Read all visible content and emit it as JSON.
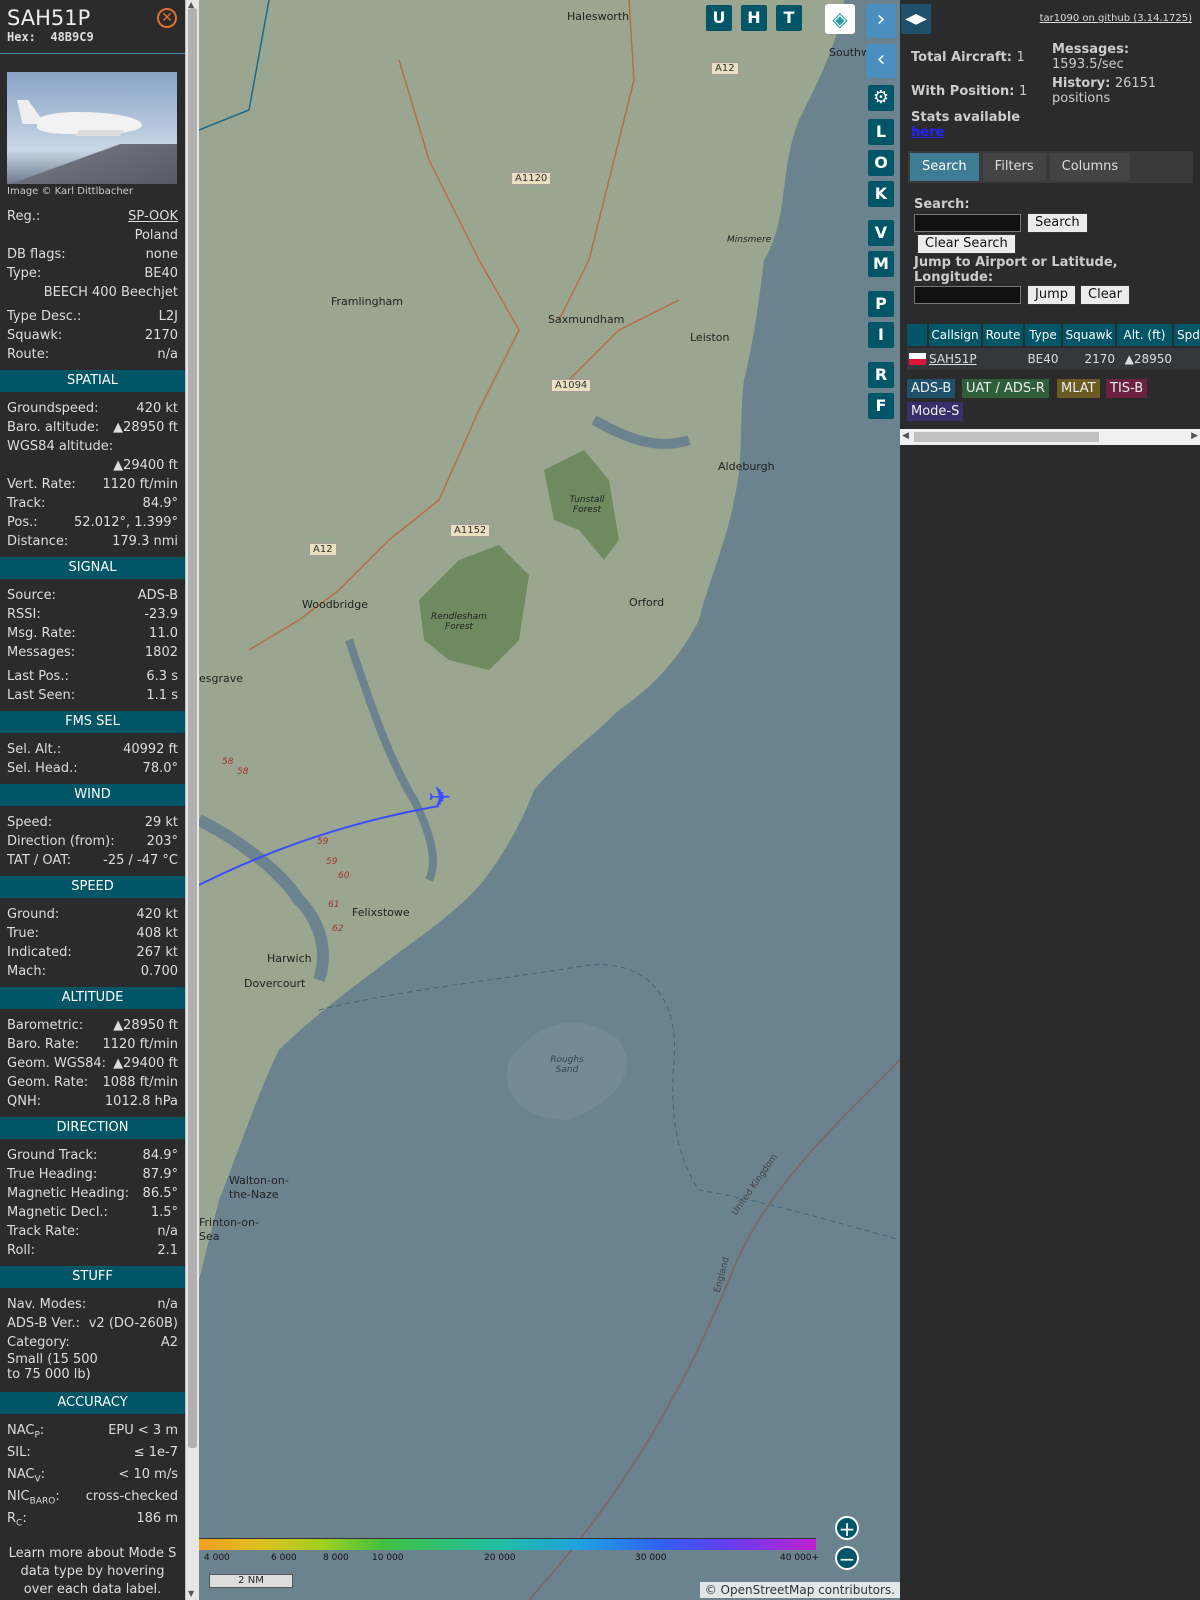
{
  "aircraft": {
    "callsign": "SAH51P",
    "hex_label": "Hex:",
    "hex": "48B9C9",
    "image_credit": "Image © Karl Dittlbacher",
    "reg_label": "Reg.:",
    "reg": "SP-OOK",
    "country": "Poland",
    "dbflags_label": "DB flags:",
    "dbflags": "none",
    "type_label": "Type:",
    "type": "BE40",
    "type_full": "BEECH 400 Beechjet",
    "typedesc_label": "Type Desc.:",
    "typedesc": "L2J",
    "squawk_label": "Squawk:",
    "squawk": "2170",
    "route_label": "Route:",
    "route": "n/a"
  },
  "sections": {
    "spatial": "SPATIAL",
    "signal": "SIGNAL",
    "fms": "FMS SEL",
    "wind": "WIND",
    "speed": "SPEED",
    "altitude": "ALTITUDE",
    "direction": "DIRECTION",
    "stuff": "STUFF",
    "accuracy": "ACCURACY"
  },
  "spatial": {
    "gs_label": "Groundspeed:",
    "gs": "420 kt",
    "baro_label": "Baro. altitude:",
    "baro": "▲28950 ft",
    "wgs_label": "WGS84 altitude:",
    "wgs": "▲29400 ft",
    "vr_label": "Vert. Rate:",
    "vr": "1120 ft/min",
    "track_label": "Track:",
    "track": "84.9°",
    "pos_label": "Pos.:",
    "pos": "52.012°, 1.399°",
    "dist_label": "Distance:",
    "dist": "179.3 nmi"
  },
  "signal": {
    "src_label": "Source:",
    "src": "ADS-B",
    "rssi_label": "RSSI:",
    "rssi": "-23.9",
    "rate_label": "Msg. Rate:",
    "rate": "11.0",
    "msgs_label": "Messages:",
    "msgs": "1802",
    "lpos_label": "Last Pos.:",
    "lpos": "6.3 s",
    "lseen_label": "Last Seen:",
    "lseen": "1.1 s"
  },
  "fms": {
    "alt_label": "Sel. Alt.:",
    "alt": "40992 ft",
    "head_label": "Sel. Head.:",
    "head": "78.0°"
  },
  "wind": {
    "spd_label": "Speed:",
    "spd": "29 kt",
    "dir_label": "Direction (from):",
    "dir": "203°",
    "tat_label": "TAT / OAT:",
    "tat": "-25 / -47 °C"
  },
  "speed": {
    "ground_label": "Ground:",
    "ground": "420 kt",
    "true_label": "True:",
    "true": "408 kt",
    "ind_label": "Indicated:",
    "ind": "267 kt",
    "mach_label": "Mach:",
    "mach": "0.700"
  },
  "altitude": {
    "baro_label": "Barometric:",
    "baro": "▲28950 ft",
    "brate_label": "Baro. Rate:",
    "brate": "1120 ft/min",
    "geom_label": "Geom. WGS84:",
    "geom": "▲29400 ft",
    "grate_label": "Geom. Rate:",
    "grate": "1088 ft/min",
    "qnh_label": "QNH:",
    "qnh": "1012.8 hPa"
  },
  "direction": {
    "gt_label": "Ground Track:",
    "gt": "84.9°",
    "th_label": "True Heading:",
    "th": "87.9°",
    "mh_label": "Magnetic Heading:",
    "mh": "86.5°",
    "md_label": "Magnetic Decl.:",
    "md": "1.5°",
    "tr_label": "Track Rate:",
    "tr": "n/a",
    "roll_label": "Roll:",
    "roll": "2.1"
  },
  "stuff": {
    "nav_label": "Nav. Modes:",
    "nav": "n/a",
    "adsb_label": "ADS-B Ver.:",
    "adsb": "v2 (DO-260B)",
    "cat_label": "Category:",
    "cat": "A2",
    "cat_desc": "Small (15 500 to 75 000 lb)"
  },
  "accuracy": {
    "nacp_label": "NAC",
    "nacp_sub": "P",
    "nacp": "EPU < 3 m",
    "sil_label": "SIL:",
    "sil": "≤ 1e-7",
    "nacv_label": "NAC",
    "nacv_sub": "V",
    "nacv": "< 10 m/s",
    "nic_label": "NIC",
    "nic_sub": "BARO",
    "nic": "cross-checked",
    "rc_label": "R",
    "rc_sub": "C",
    "rc": "186 m"
  },
  "learn_more": "Learn more about Mode S data type by hovering over each data label.",
  "map": {
    "buttons": [
      "U",
      "H",
      "T"
    ],
    "side_buttons": [
      "L",
      "O",
      "K",
      "V",
      "M",
      "P",
      "I",
      "R",
      "F"
    ],
    "places": [
      {
        "name": "Halesworth"
      },
      {
        "name": "Southw"
      },
      {
        "name": "Framlingham"
      },
      {
        "name": "Saxmundham"
      },
      {
        "name": "Leiston"
      },
      {
        "name": "Minsmere"
      },
      {
        "name": "Aldeburgh"
      },
      {
        "name": "Tunstall Forest"
      },
      {
        "name": "Woodbridge"
      },
      {
        "name": "Rendlesham Forest"
      },
      {
        "name": "Orford"
      },
      {
        "name": "esgrave"
      },
      {
        "name": "Felixstowe"
      },
      {
        "name": "Harwich"
      },
      {
        "name": "Dovercourt"
      },
      {
        "name": "Roughs Sand"
      },
      {
        "name": "Walton-on-the-Naze"
      },
      {
        "name": "Frinton-on-Sea"
      },
      {
        "name": "United Kingdom"
      },
      {
        "name": "England"
      }
    ],
    "roads": [
      "A12",
      "A1120",
      "A1094",
      "A1152",
      "A12"
    ],
    "route_nums": [
      "58",
      "58",
      "59",
      "59",
      "60",
      "61",
      "62"
    ],
    "altitude_scale": [
      "4 000",
      "6 000",
      "8 000",
      "10 000",
      "20 000",
      "30 000",
      "40 000+"
    ],
    "scale_label": "2 NM",
    "attribution_prefix": "© ",
    "attribution_link": "OpenStreetMap",
    "attribution_suffix": " contributors."
  },
  "panel": {
    "github": "tar1090 on github (3.14.1725)",
    "total_label": "Total Aircraft:",
    "total": "1",
    "msgs_label": "Messages:",
    "msgs": "1593.5/sec",
    "withpos_label": "With Position:",
    "withpos": "1",
    "history_label": "History:",
    "history": "26151 positions",
    "stats_text": "Stats available",
    "stats_link": "here",
    "tabs": [
      "Search",
      "Filters",
      "Columns"
    ],
    "search_label": "Search:",
    "search_btn": "Search",
    "clear_search_btn": "Clear Search",
    "jump_label": "Jump to Airport or Latitude, Longitude:",
    "jump_btn": "Jump",
    "clear_btn": "Clear",
    "columns": [
      "Callsign",
      "Route",
      "Type",
      "Squawk",
      "Alt. (ft)",
      "Spd"
    ],
    "row": {
      "callsign": "SAH51P",
      "route": "",
      "type": "BE40",
      "squawk": "2170",
      "alt": "▲28950"
    },
    "legend": [
      {
        "label": "ADS-B",
        "color": "#1e4f6b"
      },
      {
        "label": "UAT / ADS-R",
        "color": "#2f5e3a"
      },
      {
        "label": "MLAT",
        "color": "#6b5a22"
      },
      {
        "label": "TIS-B",
        "color": "#6b2240"
      },
      {
        "label": "Mode-S",
        "color": "#3a2f6b"
      }
    ]
  }
}
